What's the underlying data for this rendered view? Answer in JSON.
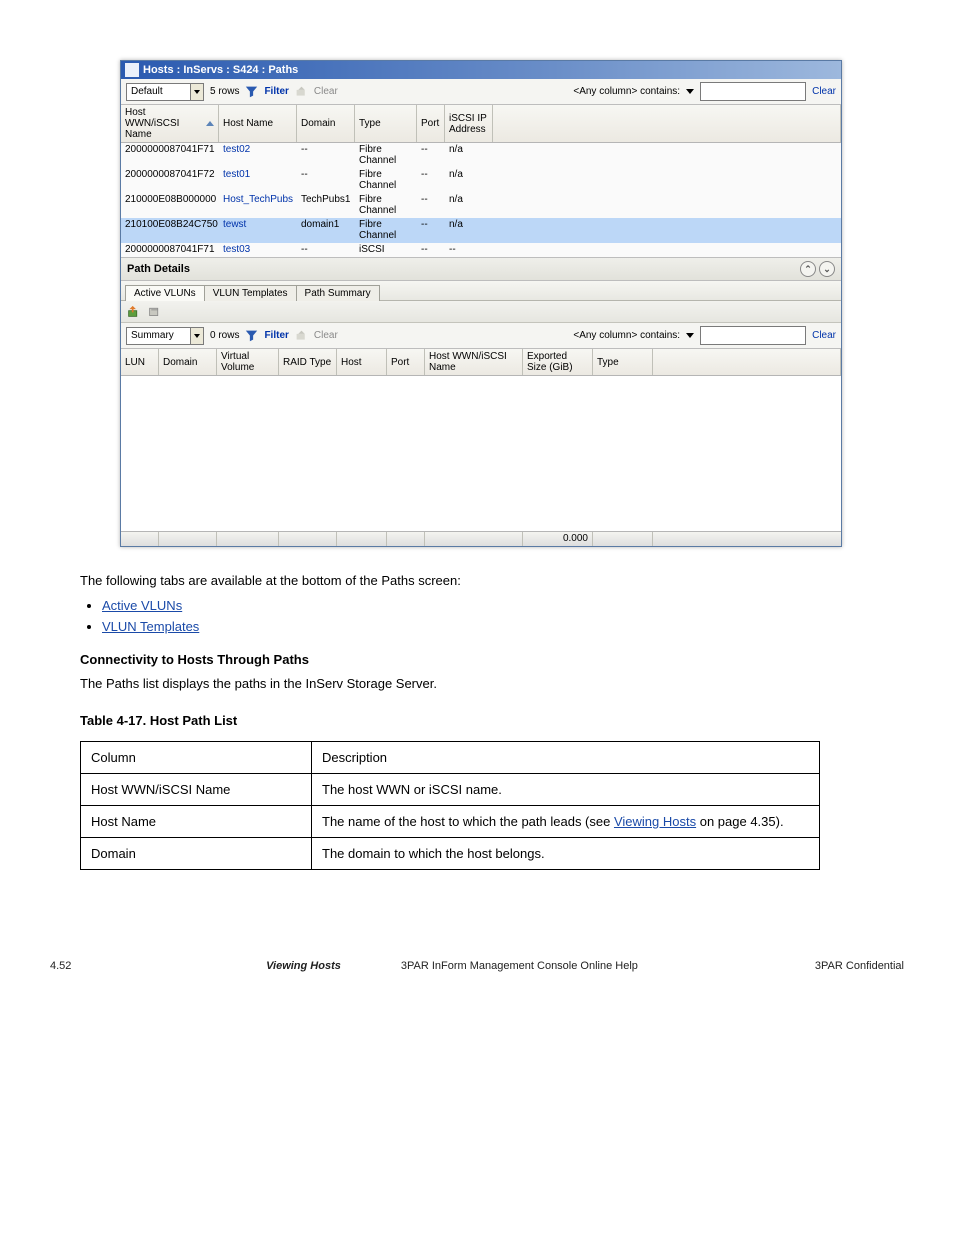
{
  "window": {
    "title": "Hosts : InServs : S424 : Paths"
  },
  "top_toolbar": {
    "view_combo": "Default",
    "rows_label": "5 rows",
    "filter_label": "Filter",
    "clear_label": "Clear",
    "filter_contains": "<Any column> contains:",
    "search_placeholder": "",
    "clear_link": "Clear"
  },
  "top_columns": {
    "c1": "Host WWN/iSCSI Name",
    "c2": "Host Name",
    "c3": "Domain",
    "c4": "Type",
    "c5": "Port",
    "c6": "iSCSI IP Address"
  },
  "top_rows": [
    {
      "wwn": "2000000087041F71",
      "host": "test02",
      "domain": "--",
      "type": "Fibre Channel",
      "port": "--",
      "ip": "n/a",
      "sel": false
    },
    {
      "wwn": "2000000087041F72",
      "host": "test01",
      "domain": "--",
      "type": "Fibre Channel",
      "port": "--",
      "ip": "n/a",
      "sel": false
    },
    {
      "wwn": "210000E08B000000",
      "host": "Host_TechPubs",
      "domain": "TechPubs1",
      "type": "Fibre Channel",
      "port": "--",
      "ip": "n/a",
      "sel": false
    },
    {
      "wwn": "210100E08B24C750",
      "host": "tewst",
      "domain": "domain1",
      "type": "Fibre Channel",
      "port": "--",
      "ip": "n/a",
      "sel": true
    },
    {
      "wwn": "2000000087041F71",
      "host": "test03",
      "domain": "--",
      "type": "iSCSI",
      "port": "--",
      "ip": "--",
      "sel": false
    }
  ],
  "path_details": {
    "title": "Path Details",
    "tabs": [
      "Active VLUNs",
      "VLUN Templates",
      "Path Summary"
    ],
    "active_tab": 0
  },
  "bot_toolbar": {
    "view_combo": "Summary",
    "rows_label": "0 rows",
    "filter_label": "Filter",
    "clear_label": "Clear",
    "filter_contains": "<Any column> contains:",
    "clear_link": "Clear"
  },
  "bot_columns": {
    "c1": "LUN",
    "c2": "Domain",
    "c3": "Virtual Volume",
    "c4": "RAID Type",
    "c5": "Host",
    "c6": "Port",
    "c7": "Host WWN/iSCSI Name",
    "c8": "Exported Size (GiB)",
    "c9": "Type"
  },
  "statusbar": {
    "size_total": "0.000"
  },
  "doc": {
    "line1": "The following tabs are available at the bottom of the Paths screen:",
    "li1": "Active VLUNs",
    "li2": "VLUN Templates",
    "sub_title": "Connectivity to Hosts Through Paths",
    "sub_p": "The Paths list displays the paths in the InServ Storage Server.",
    "table_header": "Table 4-17.  Host Path List",
    "table_rows": [
      {
        "h": "Column",
        "d": "Description"
      },
      {
        "h": "Host WWN/iSCSI Name",
        "d": "The host WWN or iSCSI name."
      },
      {
        "h": "Host Name",
        "d": "The name of the host to which the path leads (see Viewing Hosts on page 4.35)."
      },
      {
        "h": "Domain",
        "d": "The domain to which the host belongs."
      }
    ],
    "table_inline_link": "Viewing Hosts"
  },
  "footer": {
    "page": "4.52",
    "title": "Viewing Hosts",
    "doc": "3PAR InForm Management Console Online Help",
    "company": "3PAR Confidential"
  }
}
